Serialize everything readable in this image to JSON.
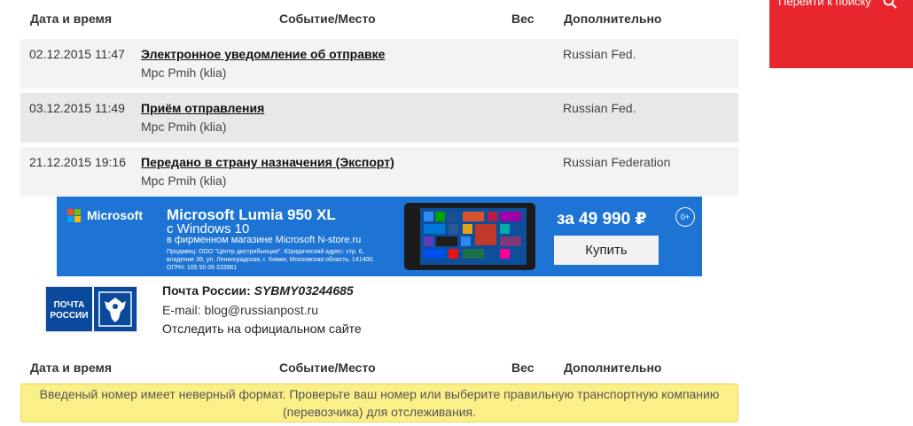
{
  "table1": {
    "headers": {
      "date": "Дата и время",
      "event": "Событие/Место",
      "weight": "Вес",
      "extra": "Дополнительно"
    },
    "rows": [
      {
        "date": "02.12.2015 11:47",
        "event": "Электронное уведомление об отправке",
        "place": "Mpc Pmih (klia)",
        "extra": "Russian Fed."
      },
      {
        "date": "03.12.2015 11:49",
        "event": "Приём отправления",
        "place": "Mpc Pmih (klia)",
        "extra": "Russian Fed."
      },
      {
        "date": "21.12.2015 19:16",
        "event": "Передано в страну назначения (Экспорт)",
        "place": "Mpc Pmih (klia)",
        "extra": "Russian Federation"
      }
    ]
  },
  "sidebar": {
    "search_label": "Перейти к поиску",
    "color": "#e8262d"
  },
  "ad": {
    "brand": "Microsoft",
    "product": "Microsoft Lumia 950 XL",
    "os": "с Windows 10",
    "shop": "в фирменном магазине Microsoft  N-store.ru",
    "legal": "Продавец: ООО \"Центр дистрибьюции\". Юридический адрес: стр. 6, владение 39, ул. Ленинградская, г. Химки, Московская область, 141400. ОГРН: 105 50 09 333961",
    "price": "за 49 990 ₽",
    "age": "0+",
    "buy_label": "Купить",
    "bg_color": "#1e74d4"
  },
  "carrier": {
    "logo_text": "ПОЧТА РОССИИ",
    "name": "Почта России:",
    "tracking": "SYBMY03244685",
    "email": "E-mail: blog@russianpost.ru",
    "track_link": "Отследить на официальном сайте"
  },
  "table2": {
    "headers": {
      "date": "Дата и время",
      "event": "Событие/Место",
      "weight": "Вес",
      "extra": "Дополнительно"
    }
  },
  "alert": {
    "message": "Введеный номер имеет неверный формат. Проверьте ваш номер или выберите правильную транспортную компанию (перевозчика) для отслеживания.",
    "bg_color": "#fbf087"
  }
}
